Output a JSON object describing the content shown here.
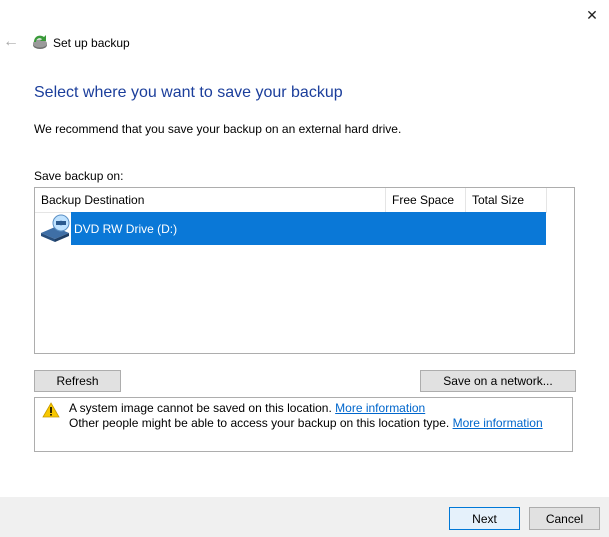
{
  "window": {
    "title": "Set up backup",
    "close_glyph": "✕",
    "back_glyph": "←"
  },
  "main": {
    "heading": "Select where you want to save your backup",
    "recommendation": "We recommend that you save your backup on an external hard drive.",
    "save_label": "Save backup on:"
  },
  "table": {
    "columns": [
      "Backup Destination",
      "Free Space",
      "Total Size"
    ],
    "rows": [
      {
        "destination": "DVD RW Drive (D:)",
        "free_space": "",
        "total_size": "",
        "selected": true,
        "icon": "dvd-drive-icon"
      }
    ]
  },
  "buttons": {
    "refresh": "Refresh",
    "save_network": "Save on a network...",
    "next": "Next",
    "cancel": "Cancel"
  },
  "warning": {
    "icon": "warning-icon",
    "line1": "A system image cannot be saved on this location.",
    "line1_link": "More information",
    "line2": "Other people might be able to access your backup on this location type.",
    "line2_link": "More information"
  },
  "colors": {
    "heading": "#1b3e9b",
    "selection": "#0a78d7",
    "link": "#0066cc",
    "footer": "#f0f0f0"
  }
}
